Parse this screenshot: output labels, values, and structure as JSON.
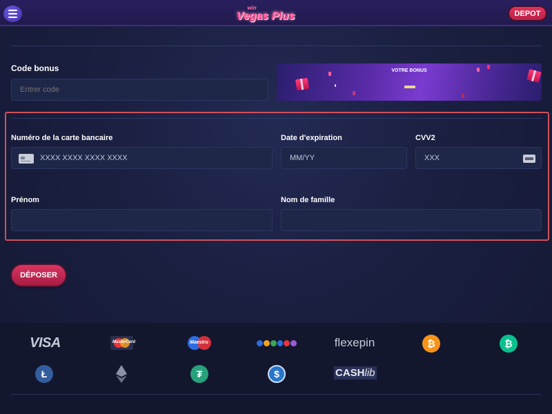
{
  "header": {
    "logo_win": "win",
    "logo_brand": "Vegas Plus",
    "deposit_label": "DEPOT"
  },
  "bonus": {
    "label": "Code bonus",
    "placeholder": "Entrer code",
    "banner_title": "VOTRE BONUS"
  },
  "card_form": {
    "card_number_label": "Numéro de la carte bancaire",
    "card_number_placeholder": "XXXX XXXX XXXX XXXX",
    "expiry_label": "Date d'expiration",
    "expiry_placeholder": "MM/YY",
    "cvv_label": "CVV2",
    "cvv_placeholder": "XXX",
    "firstname_label": "Prénom",
    "lastname_label": "Nom de famille"
  },
  "actions": {
    "submit_label": "DÉPOSER"
  },
  "payment_methods": {
    "visa": "VISA",
    "mastercard": "MasterCard",
    "maestro": "Maestro",
    "flexepin": "flexepin",
    "cashlib_cash": "CASH",
    "cashlib_lib": "lib",
    "bitcoin_symbol": "₿",
    "litecoin_symbol": "Ł",
    "tether_symbol": "₮",
    "usdc_symbol": "$"
  },
  "colors": {
    "accent": "#d93560",
    "highlight_border": "#d2505a",
    "bitcoin": "#f7931a",
    "bitcoin_cash": "#0ac18e",
    "tether": "#26a17b",
    "litecoin": "#345d9d",
    "usdc": "#2775ca"
  }
}
